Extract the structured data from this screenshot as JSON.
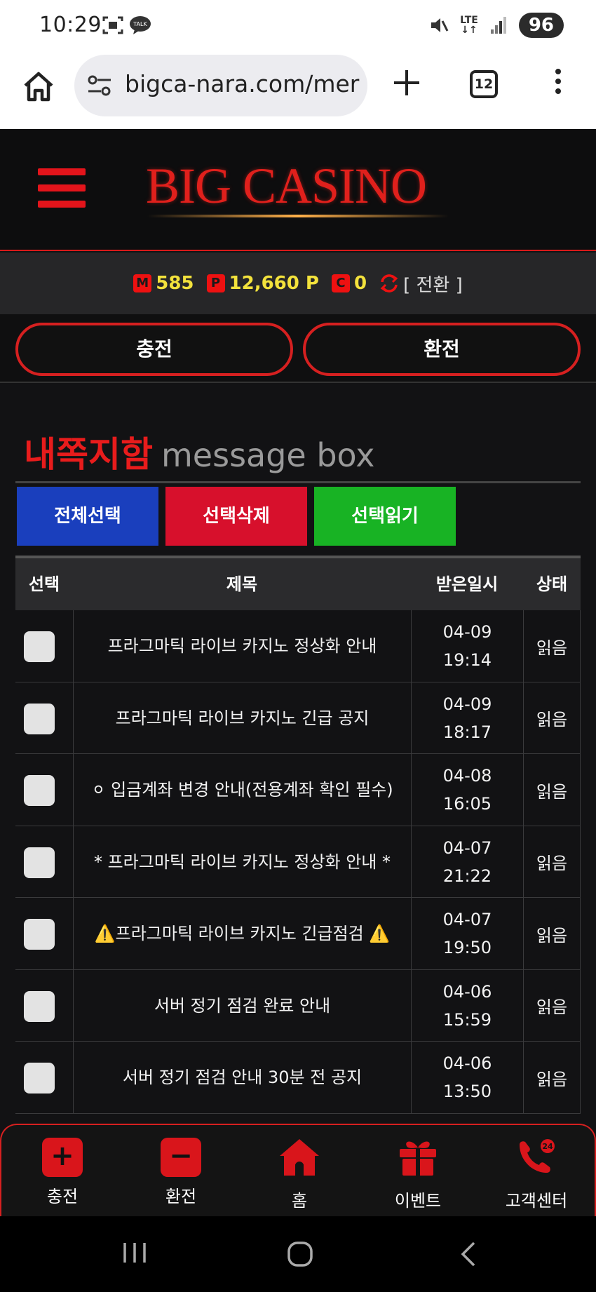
{
  "statusbar": {
    "time": "10:29",
    "talk_badge": "TALK",
    "network": "LTE",
    "battery": "96"
  },
  "browser": {
    "url": "bigca-nara.com/mer",
    "tab_count": "12"
  },
  "site": {
    "logo": "BIG CASINO"
  },
  "points": {
    "money_badge": "M",
    "money": "585",
    "point_badge": "P",
    "point": "12,660 P",
    "coin_badge": "C",
    "coin": "0",
    "convert_label": "[ 전환 ]"
  },
  "actions": {
    "deposit": "충전",
    "exchange": "환전"
  },
  "messagebox": {
    "title_kr": "내쪽지함",
    "title_en": "message box",
    "select_all": "전체선택",
    "delete_selected": "선택삭제",
    "read_selected": "선택읽기",
    "columns": [
      "선택",
      "제목",
      "받은일시",
      "상태"
    ],
    "rows": [
      {
        "subject": "프라그마틱 라이브 카지노 정상화 안내",
        "date": "04-09",
        "time": "19:14",
        "status": "읽음"
      },
      {
        "subject": "프라그마틱 라이브 카지노 긴급 공지",
        "date": "04-09",
        "time": "18:17",
        "status": "읽음"
      },
      {
        "subject": "⚪ 입금계좌 변경 안내(전용계좌 확인 필수)",
        "date": "04-08",
        "time": "16:05",
        "status": "읽음"
      },
      {
        "subject": "* 프라그마틱 라이브 카지노 정상화 안내 *",
        "date": "04-07",
        "time": "21:22",
        "status": "읽음"
      },
      {
        "subject": "⚠️프라그마틱 라이브 카지노 긴급점검 ⚠️",
        "date": "04-07",
        "time": "19:50",
        "status": "읽음"
      },
      {
        "subject": "서버 정기 점검 완료 안내",
        "date": "04-06",
        "time": "15:59",
        "status": "읽음"
      },
      {
        "subject": "서버 정기 점검 안내 30분 전 공지",
        "date": "04-06",
        "time": "13:50",
        "status": "읽음"
      }
    ]
  },
  "dock": {
    "deposit": "충전",
    "exchange": "환전",
    "home": "홈",
    "event": "이벤트",
    "support": "고객센터",
    "support_badge": "24"
  },
  "colors": {
    "accent_red": "#e3141b",
    "points_yellow": "#f3e23c",
    "blue_button": "#1a3fbd",
    "red_button": "#d7102c",
    "green_button": "#18b324"
  }
}
